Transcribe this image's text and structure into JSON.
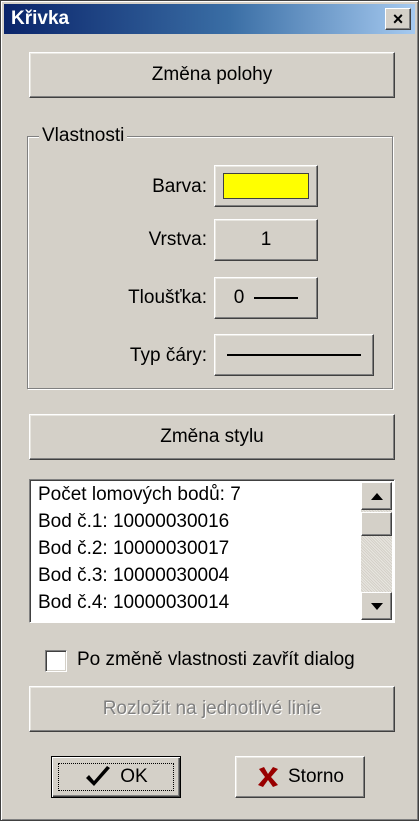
{
  "window": {
    "title": "Křivka",
    "close_glyph": "×"
  },
  "buttons": {
    "position_change": "Změna polohy",
    "style_change": "Změna stylu",
    "decompose": "Rozložit na jednotlivé linie",
    "ok": "OK",
    "cancel": "Storno"
  },
  "properties": {
    "group_title": "Vlastnosti",
    "color_label": "Barva:",
    "color_value": "#ffff00",
    "layer_label": "Vrstva:",
    "layer_value": "1",
    "thickness_label": "Tloušťka:",
    "thickness_value": "0",
    "line_type_label": "Typ čáry:"
  },
  "points_list": {
    "items": [
      "Počet lomových bodů: 7",
      "Bod č.1: 10000030016",
      "Bod č.2: 10000030017",
      "Bod č.3: 10000030004",
      "Bod č.4: 10000030014"
    ]
  },
  "options": {
    "close_after_change_label": "Po změně vlastnosti zavřít dialog",
    "close_after_change_checked": false
  },
  "icons": {
    "ok": "checkmark-icon",
    "cancel": "red-x-icon"
  }
}
